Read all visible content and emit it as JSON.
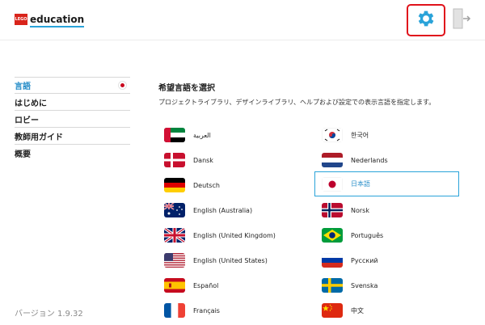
{
  "header": {
    "logo_box": "LEGO",
    "logo_text": "education",
    "settings_icon": "gear-icon",
    "exit_icon": "exit-door-icon",
    "accent_color": "#2aa3d9",
    "highlight_color": "#e0121b"
  },
  "sidebar": {
    "items": [
      {
        "label": "言語",
        "active": true
      },
      {
        "label": "はじめに"
      },
      {
        "label": "ロビー"
      },
      {
        "label": "教師用ガイド"
      },
      {
        "label": "概要"
      }
    ]
  },
  "version": "バージョン 1.9.32",
  "main": {
    "title": "希望言語を選択",
    "description": "プロジェクトライブラリ、デザインライブラリ、ヘルプおよび設定での表示言語を指定します。",
    "languages": [
      {
        "label": "العربية",
        "flag": "uae-flag-icon"
      },
      {
        "label": "한국어",
        "flag": "korea-flag-icon"
      },
      {
        "label": "Dansk",
        "flag": "denmark-flag-icon"
      },
      {
        "label": "Nederlands",
        "flag": "netherlands-flag-icon"
      },
      {
        "label": "Deutsch",
        "flag": "germany-flag-icon"
      },
      {
        "label": "日本語",
        "flag": "japan-flag-icon",
        "selected": true
      },
      {
        "label": "English (Australia)",
        "flag": "australia-flag-icon"
      },
      {
        "label": "Norsk",
        "flag": "norway-flag-icon"
      },
      {
        "label": "English (United Kingdom)",
        "flag": "uk-flag-icon"
      },
      {
        "label": "Português",
        "flag": "brazil-flag-icon"
      },
      {
        "label": "English (United States)",
        "flag": "usa-flag-icon"
      },
      {
        "label": "Русский",
        "flag": "russia-flag-icon"
      },
      {
        "label": "Español",
        "flag": "spain-flag-icon"
      },
      {
        "label": "Svenska",
        "flag": "sweden-flag-icon"
      },
      {
        "label": "Français",
        "flag": "france-flag-icon"
      },
      {
        "label": "中文",
        "flag": "china-flag-icon"
      }
    ]
  }
}
